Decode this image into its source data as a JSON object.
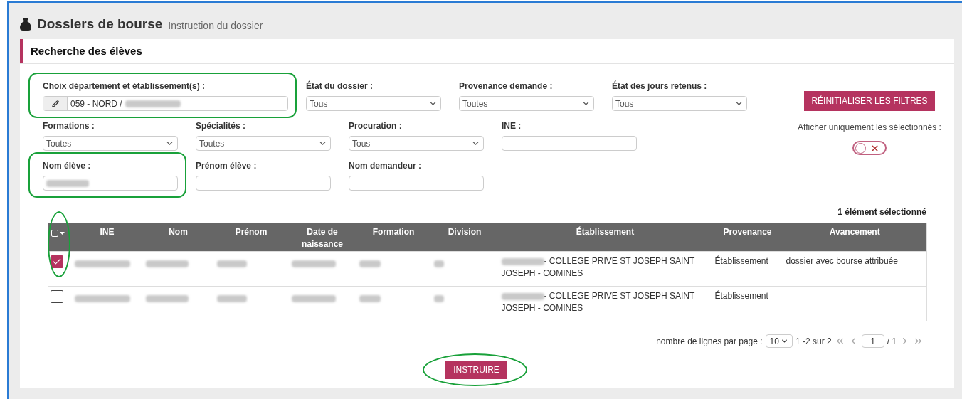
{
  "header": {
    "title": "Dossiers de bourse",
    "subtitle": "Instruction du dossier"
  },
  "section_title": "Recherche des élèves",
  "filter_rows": [
    [
      {
        "kind": "picker",
        "label": "Choix département et établissement(s) :",
        "value": "059 - NORD /",
        "redacted": true,
        "highlighted": true
      },
      {
        "kind": "select",
        "label": "État du dossier :",
        "value": "Tous"
      },
      {
        "kind": "select",
        "label": "Provenance demande :",
        "value": "Toutes"
      },
      {
        "kind": "select",
        "label": "État des jours retenus :",
        "value": "Tous"
      }
    ],
    [
      {
        "kind": "select",
        "label": "Formations :",
        "value": "Toutes"
      },
      {
        "kind": "select",
        "label": "Spécialités :",
        "value": "Toutes"
      },
      {
        "kind": "select",
        "label": "Procuration :",
        "value": "Tous"
      },
      {
        "kind": "text",
        "label": "INE :"
      }
    ],
    [
      {
        "kind": "text",
        "label": "Nom élève :",
        "redacted": true,
        "highlighted": true
      },
      {
        "kind": "text",
        "label": "Prénom élève :"
      },
      {
        "kind": "text",
        "label": "Nom demandeur :"
      }
    ]
  ],
  "reset_button": "RÉINITIALISER LES FILTRES",
  "toggle": {
    "label": "Afficher uniquement les sélectionnés :",
    "on": false
  },
  "table": {
    "selection_summary": "1 élément sélectionné",
    "select_column_highlighted": true,
    "select_all_checked": false,
    "columns": [
      "INE",
      "Nom",
      "Prénom",
      "Date de naissance",
      "Formation",
      "Division",
      "Établissement",
      "Provenance",
      "Avancement"
    ],
    "rows": [
      {
        "selected": true,
        "cells": [
          {
            "kind": "blurred"
          },
          {
            "kind": "blurred"
          },
          {
            "kind": "blurred"
          },
          {
            "kind": "blurred"
          },
          {
            "kind": "blurred"
          },
          {
            "kind": "blurred"
          },
          {
            "kind": "prefixed",
            "text": "- COLLEGE PRIVE ST JOSEPH SAINT JOSEPH - COMINES"
          },
          {
            "kind": "text",
            "text": "Établissement"
          },
          {
            "kind": "text",
            "text": "dossier avec bourse attribuée"
          }
        ]
      },
      {
        "selected": false,
        "cells": [
          {
            "kind": "blurred"
          },
          {
            "kind": "blurred"
          },
          {
            "kind": "blurred"
          },
          {
            "kind": "blurred"
          },
          {
            "kind": "blurred"
          },
          {
            "kind": "blurred"
          },
          {
            "kind": "prefixed",
            "text": "- COLLEGE PRIVE ST JOSEPH SAINT JOSEPH - COMINES"
          },
          {
            "kind": "text",
            "text": "Établissement"
          }
        ]
      }
    ]
  },
  "pagination": {
    "label": "nombre de lignes par page :",
    "page_size": "10",
    "range": "1 -2 sur 2",
    "page": "1",
    "total": "/ 1"
  },
  "submit_button": {
    "label": "INSTRUIRE",
    "highlighted": true
  }
}
